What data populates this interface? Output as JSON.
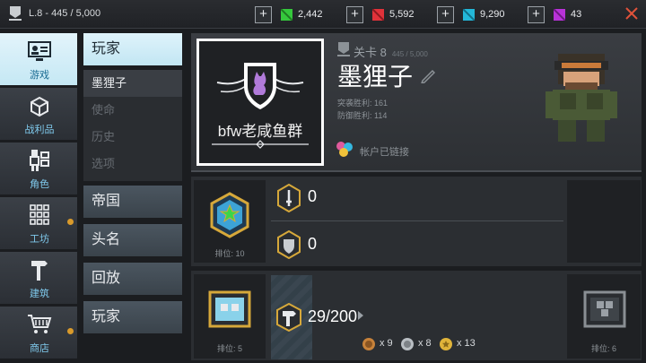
{
  "topbar": {
    "level_text": "L.8 - 445 / 5,000",
    "resources": [
      {
        "name": "green-gem",
        "value": "2,442",
        "color": "#35c83c"
      },
      {
        "name": "red-gem",
        "value": "5,592",
        "color": "#e0323a"
      },
      {
        "name": "cyan-gem",
        "value": "9,290",
        "color": "#23b7d8"
      },
      {
        "name": "purple-gem",
        "value": "43",
        "color": "#b832d8"
      }
    ]
  },
  "nav": {
    "items": [
      {
        "label": "游戏",
        "icon": "id-card-icon"
      },
      {
        "label": "战利品",
        "icon": "loot-box-icon"
      },
      {
        "label": "角色",
        "icon": "character-icon"
      },
      {
        "label": "工坊",
        "icon": "grid-icon"
      },
      {
        "label": "建筑",
        "icon": "hammer-icon"
      },
      {
        "label": "商店",
        "icon": "cart-icon"
      }
    ]
  },
  "submenu": {
    "player": "玩家",
    "list": [
      "墨狸子",
      "使命",
      "历史",
      "选项"
    ],
    "buttons": [
      "帝国",
      "头名",
      "回放",
      "玩家"
    ]
  },
  "profile": {
    "clan_name": "bfw老咸鱼群",
    "level": "关卡 8",
    "xp": "445 / 5,000",
    "player_name": "墨狸子",
    "raid_wins": "突袭胜利: 161",
    "defense_wins": "防御胜利: 114",
    "linked": "帐户已链接"
  },
  "rank": {
    "label": "排位: 10",
    "attack_value": "0",
    "defense_value": "0"
  },
  "workshop": {
    "label_left": "排位: 5",
    "label_right": "排位: 6",
    "progress": "29/200",
    "medals": [
      {
        "name": "bronze-medal",
        "count": "x 9"
      },
      {
        "name": "silver-medal",
        "count": "x 8"
      },
      {
        "name": "gold-medal",
        "count": "x 13"
      }
    ]
  },
  "colors": {
    "accent_light": "#c5e8f4",
    "nav_label": "#7fc9ec",
    "notify_dot": "#d99a2b"
  }
}
